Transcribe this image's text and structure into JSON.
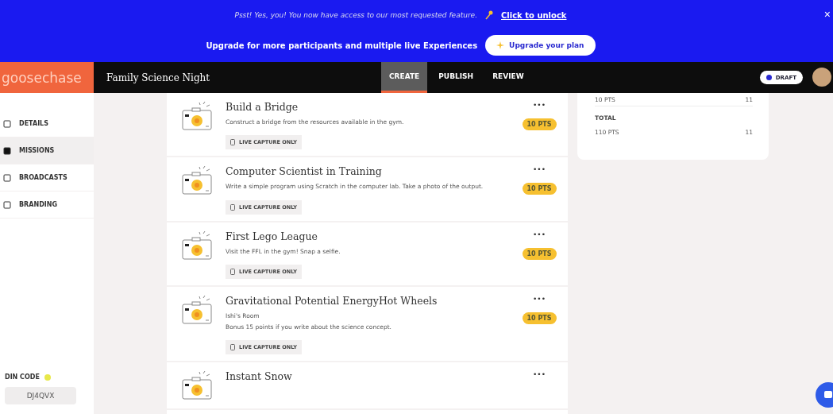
{
  "banner": {
    "message": "Psst! Yes, you! You now have access to our most requested feature.",
    "link": "Click to unlock",
    "close": "×",
    "upgrade_text": "Upgrade for more participants and multiple live Experiences",
    "upgrade_button": "Upgrade your plan"
  },
  "nav": {
    "logo": "goosechase",
    "title": "Family Science Night",
    "tabs": [
      {
        "label": "CREATE",
        "selected": true
      },
      {
        "label": "PUBLISH",
        "selected": false
      },
      {
        "label": "REVIEW",
        "selected": false
      }
    ],
    "status": "DRAFT"
  },
  "sidebar": {
    "items": [
      {
        "label": "DETAILS",
        "selected": false
      },
      {
        "label": "MISSIONS",
        "selected": true
      },
      {
        "label": "BROADCASTS",
        "selected": false
      },
      {
        "label": "BRANDING",
        "selected": false
      }
    ],
    "join_code_label": "DIN CODE",
    "join_code": "DJ4QVX"
  },
  "missions": [
    {
      "title": "Build a Bridge",
      "description": [
        "Construct a bridge from the resources available in the gym."
      ],
      "tag": "LIVE CAPTURE ONLY",
      "points": "10 PTS",
      "menu": "•••"
    },
    {
      "title": "Computer Scientist in Training",
      "description": [
        "Write a simple program using Scratch in the computer lab. Take a photo of the output."
      ],
      "tag": "LIVE CAPTURE ONLY",
      "points": "10 PTS",
      "menu": "•••"
    },
    {
      "title": "First Lego League",
      "description": [
        "Visit the FFL in the gym! Snap a selfie."
      ],
      "tag": "LIVE CAPTURE ONLY",
      "points": "10 PTS",
      "menu": "•••"
    },
    {
      "title": "Gravitational Potential EnergyHot Wheels",
      "description": [
        "Ishi's Room",
        "Bonus 15 points if you write about the science concept."
      ],
      "tag": "LIVE CAPTURE ONLY",
      "points": "10 PTS",
      "menu": "•••"
    },
    {
      "title": "Instant Snow",
      "menu": "•••"
    }
  ],
  "summary": {
    "rows": [
      {
        "value": "10 PTS",
        "count": "11"
      },
      {
        "label": "TOTAL",
        "value": "110 PTS",
        "count": "11"
      }
    ]
  }
}
